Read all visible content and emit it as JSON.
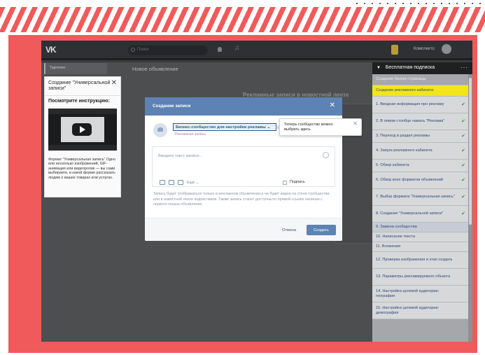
{
  "vk": {
    "logo": "VK",
    "search_placeholder": "Поиск",
    "user_name": "Комплекто"
  },
  "left_nav": {
    "active_item": "Таргетинг"
  },
  "page": {
    "title": "Новое объявление",
    "subtitle": "Рекламные записи в новостной ленте"
  },
  "instructions": {
    "title": "Создание \"Универсальной записи\"",
    "close": "✕",
    "heading": "Посмотрите инструкцию:",
    "text": "Формат \"Универсальная запись\" Одно или несколько изображений, GIF-анимация или видеоролик — вы сами выбираете, в какой форме рассказать людям о ваших товарах или услугах."
  },
  "modal": {
    "title": "Создание записи",
    "close": "✕",
    "community": "Бизнес-сообщество для настройки рекламы",
    "community_caret": "⌄",
    "community_sub": "Рекламная запись",
    "text_placeholder": "Введите текст записи...",
    "more_label": "Ещё ⌄",
    "signature_label": "Подпись",
    "note": "Запись будет отображаться только в рекламном объявлении и не будет видна на стене сообщества или в новостной ленте подписчиков. Также запись станет доступна по прямой ссылке начиная с первого показа объявления.",
    "cancel": "Отмена",
    "create": "Создать"
  },
  "tooltip": {
    "text": "Теперь сообщество можно выбрать здесь",
    "close": "✕"
  },
  "sidebar": {
    "header": "Бесплатная подписка",
    "menu": "···",
    "items": [
      {
        "label": "Создание бизнес-страницы",
        "state": "gray"
      },
      {
        "label": "Создание рекламного кабинета",
        "state": "highlight"
      },
      {
        "label": "1. Вводная информация про рекламу",
        "state": "done"
      },
      {
        "label": "2. В левом столбце нажать \"Реклама\"",
        "state": "done"
      },
      {
        "label": "3. Переход в раздел рекламы",
        "state": "done"
      },
      {
        "label": "4. Запуск рекламного кабинета",
        "state": "done"
      },
      {
        "label": "5. Обзор кабинета",
        "state": "done"
      },
      {
        "label": "6. Обзор всех форматов объявлений",
        "state": "done"
      },
      {
        "label": "7. Выбор формата \"Универсальная запись\"",
        "state": "done"
      },
      {
        "label": "8. Создание \"Универсальной записи\"",
        "state": "done"
      },
      {
        "label": "9. Замена сообщества",
        "state": "current"
      },
      {
        "label": "10. Написание текста",
        "state": "todo"
      },
      {
        "label": "11. Вложения",
        "state": "todo"
      },
      {
        "label": "12. Проверка изображения и этап создать",
        "state": "todo"
      },
      {
        "label": "13. Параметры рекламируемого объекта",
        "state": "todo"
      },
      {
        "label": "14. Настройка целевой аудитории: география",
        "state": "todo"
      },
      {
        "label": "15. Настройка целевой аудитории: демография",
        "state": "todo"
      }
    ],
    "check": "✔"
  },
  "colors": {
    "frame": "#f05a5a",
    "modal_header": "#5d82b4",
    "highlight": "#f2e51a",
    "current_item": "#c6ccd6",
    "check": "#2e9e2e"
  }
}
